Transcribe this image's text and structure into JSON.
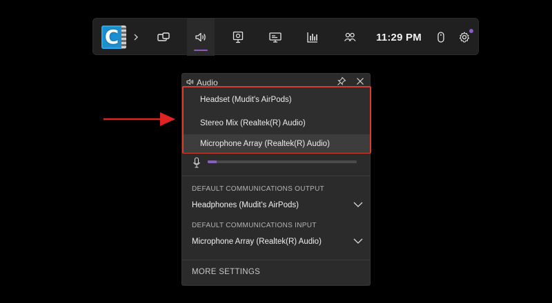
{
  "gamebar": {
    "app_letter": "C",
    "clock": "11:29 PM",
    "widgets": [
      {
        "name": "capture",
        "icon": "capture-icon"
      },
      {
        "name": "audio",
        "icon": "speaker-icon",
        "active": true
      },
      {
        "name": "resources",
        "icon": "monitor-icon"
      },
      {
        "name": "display",
        "icon": "display-icon"
      },
      {
        "name": "performance",
        "icon": "bar-chart-icon"
      },
      {
        "name": "social",
        "icon": "people-icon"
      }
    ],
    "accent": "#8a5cc8"
  },
  "audio_panel": {
    "title": "Audio",
    "device_dropdown": {
      "highlight_color": "#d93a3a",
      "options": [
        "Headset (Mudit's AirPods)",
        "Stereo Mix (Realtek(R) Audio)",
        "Microphone Array (Realtek(R) Audio)"
      ],
      "hovered_index": 2
    },
    "mic_level": 0.06,
    "default_output": {
      "label": "DEFAULT COMMUNICATIONS OUTPUT",
      "value": "Headphones (Mudit's AirPods)"
    },
    "default_input": {
      "label": "DEFAULT COMMUNICATIONS INPUT",
      "value": "Microphone Array (Realtek(R) Audio)"
    },
    "more_settings": "MORE SETTINGS"
  }
}
